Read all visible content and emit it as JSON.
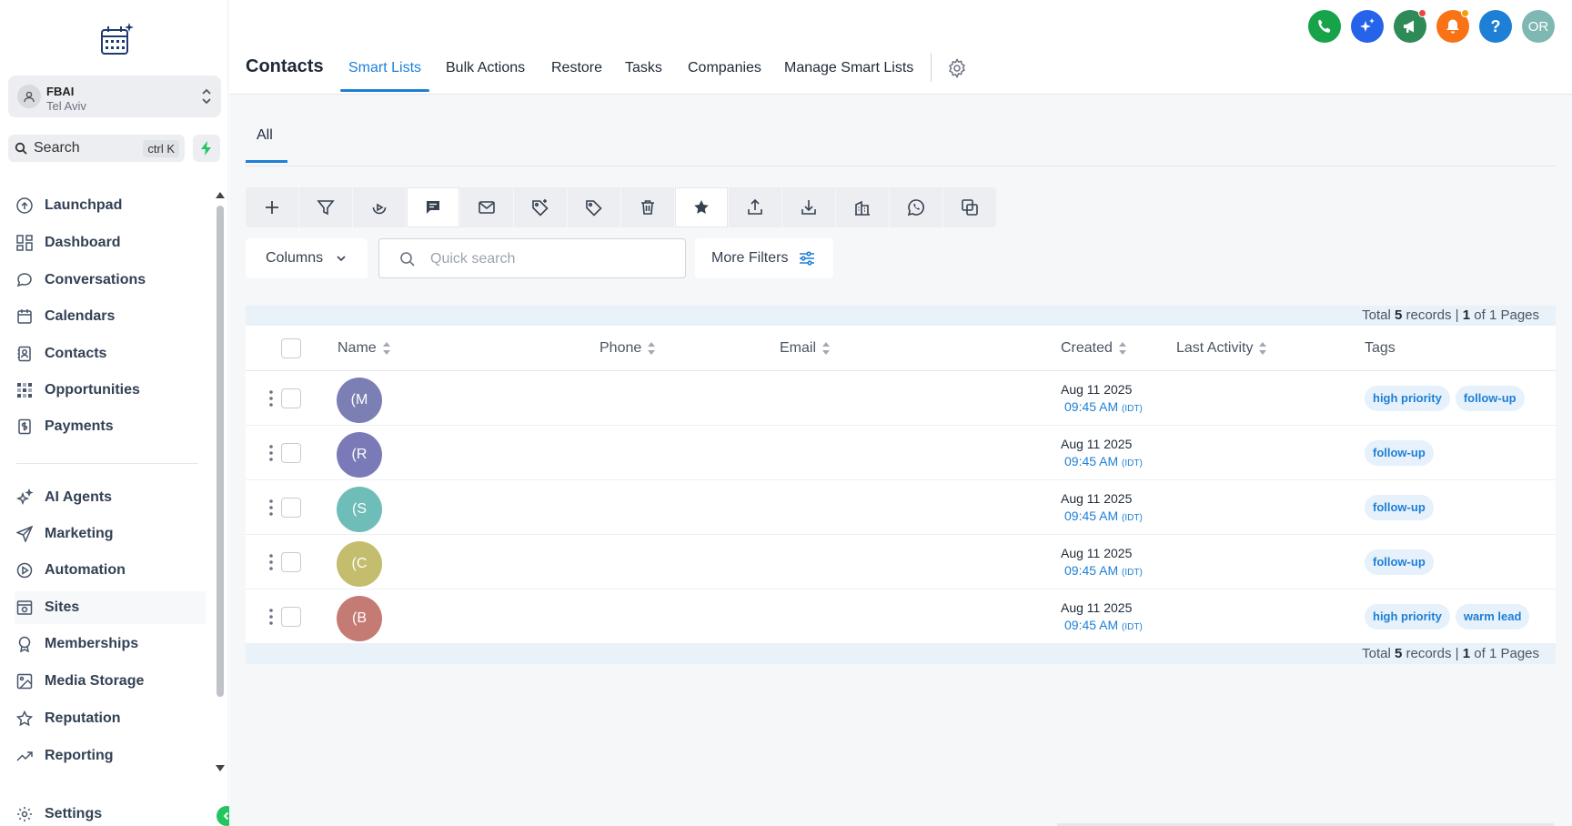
{
  "sidebar": {
    "account": {
      "name": "FBAI",
      "location": "Tel Aviv"
    },
    "search": {
      "label": "Search",
      "shortcut": "ctrl K"
    },
    "nav_primary": [
      {
        "label": "Launchpad",
        "icon": "launchpad-icon"
      },
      {
        "label": "Dashboard",
        "icon": "grid-icon"
      },
      {
        "label": "Conversations",
        "icon": "chat-icon"
      },
      {
        "label": "Calendars",
        "icon": "calendar-icon"
      },
      {
        "label": "Contacts",
        "icon": "contacts-icon"
      },
      {
        "label": "Opportunities",
        "icon": "opportunities-icon"
      },
      {
        "label": "Payments",
        "icon": "payments-icon"
      }
    ],
    "nav_secondary": [
      {
        "label": "AI Agents",
        "icon": "sparkle-icon"
      },
      {
        "label": "Marketing",
        "icon": "send-icon"
      },
      {
        "label": "Automation",
        "icon": "automation-icon"
      },
      {
        "label": "Sites",
        "icon": "sites-icon"
      },
      {
        "label": "Memberships",
        "icon": "award-icon"
      },
      {
        "label": "Media Storage",
        "icon": "image-icon"
      },
      {
        "label": "Reputation",
        "icon": "star-icon"
      },
      {
        "label": "Reporting",
        "icon": "trend-icon"
      }
    ],
    "settings": {
      "label": "Settings",
      "icon": "gear-icon"
    }
  },
  "header": {
    "title": "Contacts",
    "tabs": [
      {
        "label": "Smart Lists",
        "active": true
      },
      {
        "label": "Bulk Actions"
      },
      {
        "label": "Restore"
      },
      {
        "label": "Tasks"
      },
      {
        "label": "Companies"
      },
      {
        "label": "Manage Smart Lists"
      }
    ],
    "user_initials": "OR",
    "help_label": "?"
  },
  "smart_list": {
    "tab": "All"
  },
  "filters": {
    "columns_label": "Columns",
    "quick_search_placeholder": "Quick search",
    "more_filters_label": "More Filters"
  },
  "table": {
    "totals": {
      "prefix": "Total",
      "records": "5",
      "records_suffix": "records |",
      "page": "1",
      "pages_suffix": "of 1 Pages"
    },
    "columns": {
      "name": "Name",
      "phone": "Phone",
      "email": "Email",
      "created": "Created",
      "last_activity": "Last Activity",
      "tags": "Tags"
    },
    "rows": [
      {
        "initial": "(M",
        "color": "#7c7fb3",
        "date": "Aug 11 2025",
        "time": "09:45 AM",
        "tz": "(IDT)",
        "tags": [
          "high priority",
          "follow-up"
        ]
      },
      {
        "initial": "(R",
        "color": "#7a7ab8",
        "date": "Aug 11 2025",
        "time": "09:45 AM",
        "tz": "(IDT)",
        "tags": [
          "follow-up"
        ]
      },
      {
        "initial": "(S",
        "color": "#6fbdb8",
        "date": "Aug 11 2025",
        "time": "09:45 AM",
        "tz": "(IDT)",
        "tags": [
          "follow-up"
        ]
      },
      {
        "initial": "(C",
        "color": "#c4bd6e",
        "date": "Aug 11 2025",
        "time": "09:45 AM",
        "tz": "(IDT)",
        "tags": [
          "follow-up"
        ]
      },
      {
        "initial": "(B",
        "color": "#c47b73",
        "date": "Aug 11 2025",
        "time": "09:45 AM",
        "tz": "(IDT)",
        "tags": [
          "high priority",
          "warm lead"
        ]
      }
    ]
  },
  "colors": {
    "accent": "#1d7fd6",
    "success": "#22c55e",
    "alert": "#f97316"
  }
}
